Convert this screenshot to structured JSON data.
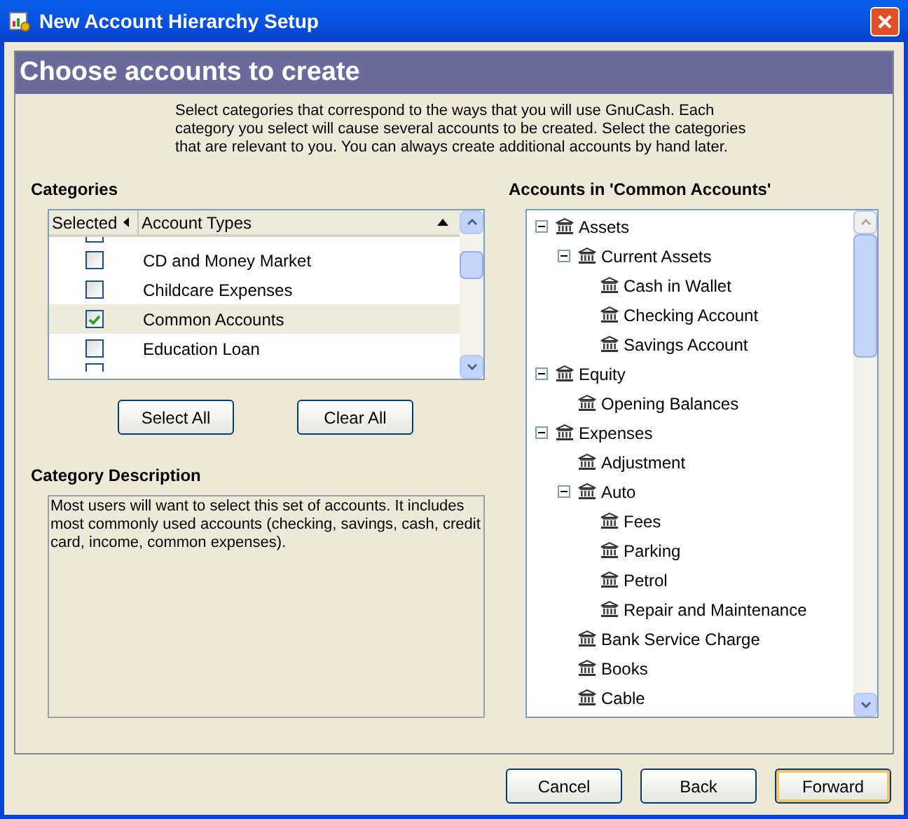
{
  "window": {
    "title": "New Account Hierarchy Setup"
  },
  "header": {
    "title": "Choose accounts to create"
  },
  "intro": "Select categories that correspond to the ways that you will use GnuCash.  Each category you select will cause several accounts to be created.  Select the categories that are relevant to you.  You can always create additional accounts by hand later.",
  "categories": {
    "label": "Categories",
    "columns": [
      "Selected",
      "Account Types"
    ],
    "rows": [
      {
        "name": "CD and Money Market",
        "checked": false,
        "selected": false
      },
      {
        "name": "Childcare Expenses",
        "checked": false,
        "selected": false
      },
      {
        "name": "Common Accounts",
        "checked": true,
        "selected": true
      },
      {
        "name": "Education Loan",
        "checked": false,
        "selected": false
      }
    ],
    "buttons": [
      "Select All",
      "Clear All"
    ]
  },
  "description": {
    "label": "Category Description",
    "text": "Most users will want to select this set of accounts. It includes most commonly used accounts (checking, savings, cash, credit card, income, common expenses)."
  },
  "accounts": {
    "label": "Accounts in 'Common Accounts'",
    "tree": [
      {
        "name": "Assets",
        "expanded": true,
        "children": [
          {
            "name": "Current Assets",
            "expanded": true,
            "children": [
              {
                "name": "Cash in Wallet"
              },
              {
                "name": "Checking Account"
              },
              {
                "name": "Savings Account"
              }
            ]
          }
        ]
      },
      {
        "name": "Equity",
        "expanded": true,
        "children": [
          {
            "name": "Opening Balances"
          }
        ]
      },
      {
        "name": "Expenses",
        "expanded": true,
        "children": [
          {
            "name": "Adjustment"
          },
          {
            "name": "Auto",
            "expanded": true,
            "children": [
              {
                "name": "Fees"
              },
              {
                "name": "Parking"
              },
              {
                "name": "Petrol"
              },
              {
                "name": "Repair and Maintenance"
              }
            ]
          },
          {
            "name": "Bank Service Charge"
          },
          {
            "name": "Books"
          },
          {
            "name": "Cable"
          }
        ]
      }
    ]
  },
  "buttons": [
    {
      "label": "Cancel",
      "default": false
    },
    {
      "label": "Back",
      "default": false
    },
    {
      "label": "Forward",
      "default": true
    }
  ]
}
